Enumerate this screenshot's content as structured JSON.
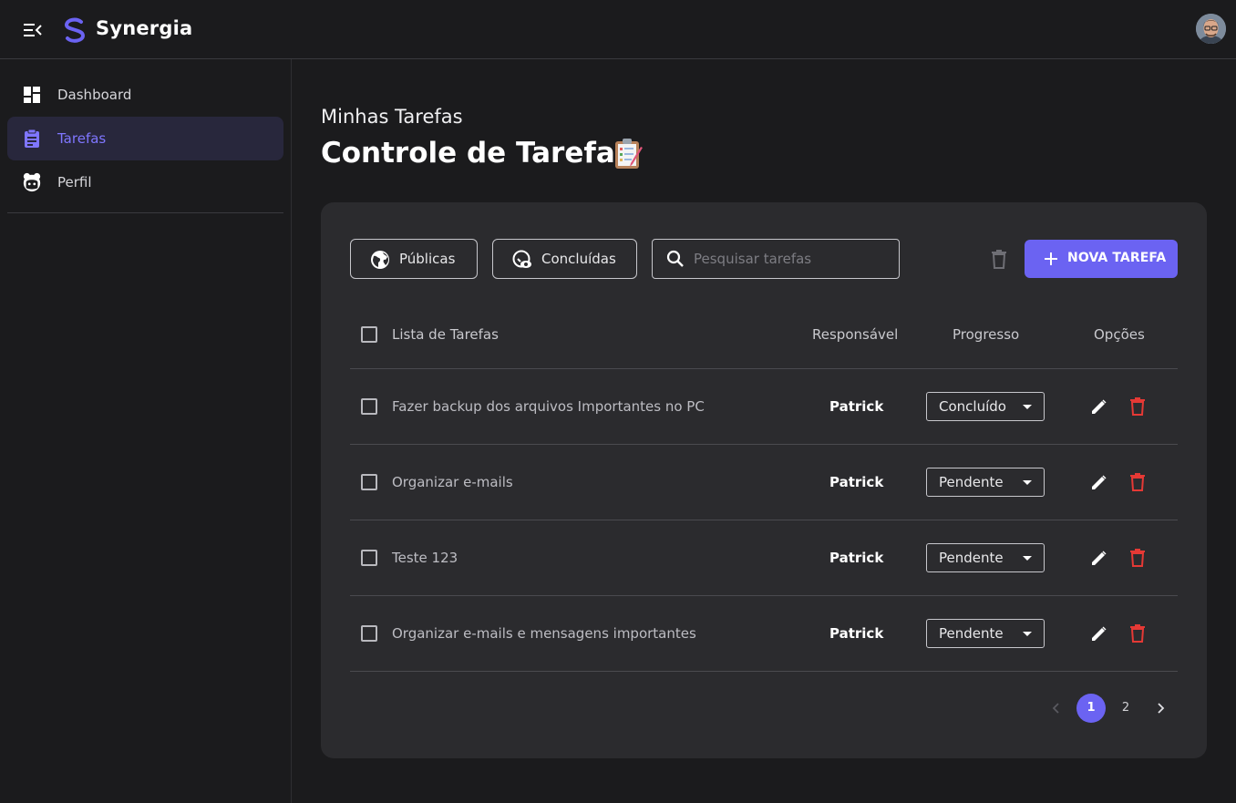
{
  "header": {
    "brand": "Synergia",
    "menu_icon": "menu-collapse-icon",
    "logo_icon": "synergia-logo",
    "avatar_icon": "user-avatar"
  },
  "sidebar": {
    "items": [
      {
        "label": "Dashboard",
        "icon": "dashboard-icon",
        "active": false
      },
      {
        "label": "Tarefas",
        "icon": "clipboard-icon",
        "active": true
      },
      {
        "label": "Perfil",
        "icon": "profile-face-icon",
        "active": false
      }
    ]
  },
  "page": {
    "subtitle": "Minhas Tarefas",
    "title": "Controle de Tarefas",
    "title_icon": "clipboard-emoji"
  },
  "toolbar": {
    "public_label": "Públicas",
    "completed_label": "Concluídas",
    "search_placeholder": "Pesquisar tarefas",
    "search_value": "",
    "new_task_label": "NOVA TAREFA"
  },
  "table": {
    "headers": {
      "task": "Lista de Tarefas",
      "responsible": "Responsável",
      "progress": "Progresso",
      "options": "Opções"
    },
    "rows": [
      {
        "task": "Fazer backup dos arquivos Importantes no PC",
        "responsible": "Patrick",
        "progress": "Concluído"
      },
      {
        "task": "Organizar e-mails",
        "responsible": "Patrick",
        "progress": "Pendente"
      },
      {
        "task": "Teste 123",
        "responsible": "Patrick",
        "progress": "Pendente"
      },
      {
        "task": "Organizar e-mails e mensagens importantes",
        "responsible": "Patrick",
        "progress": "Pendente"
      }
    ]
  },
  "pagination": {
    "pages": [
      "1",
      "2"
    ],
    "current": "1"
  },
  "colors": {
    "accent": "#6b63f2",
    "active_text": "#7f76ff",
    "danger": "#e53935",
    "background": "#1b1b1d",
    "card": "#2b2b2e"
  }
}
